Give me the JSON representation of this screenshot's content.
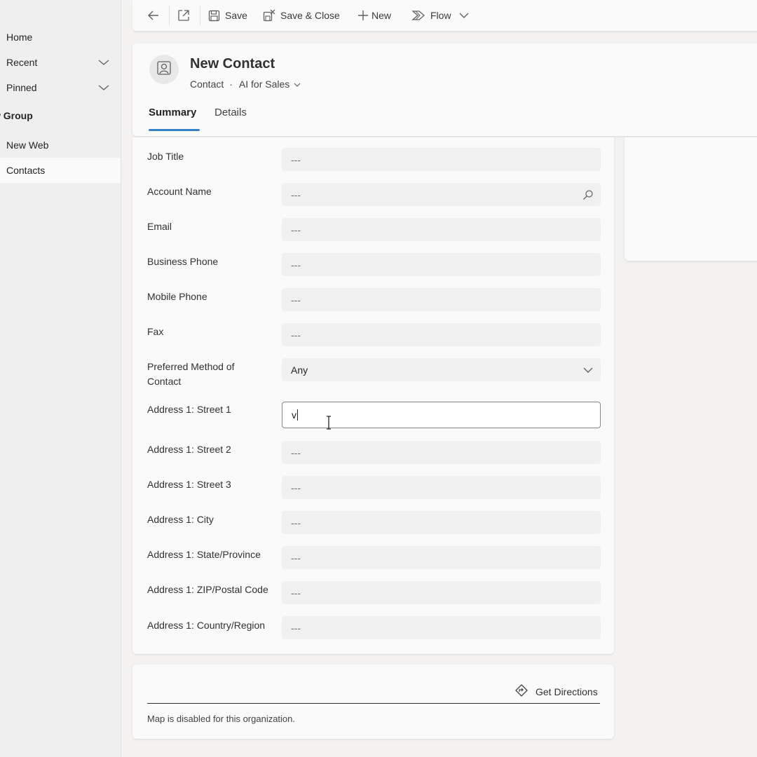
{
  "sidebar": {
    "home": "Home",
    "recent": "Recent",
    "pinned": "Pinned",
    "group": "w Group",
    "items": [
      "New Web",
      "Contacts"
    ]
  },
  "toolbar": {
    "save": "Save",
    "save_close": "Save & Close",
    "new": "New",
    "flow": "Flow"
  },
  "header": {
    "title": "New Contact",
    "entity": "Contact",
    "form_selector": "AI for Sales",
    "tabs": [
      "Summary",
      "Details"
    ],
    "selected_tab": "Summary"
  },
  "form": {
    "fields": [
      {
        "label": "Job Title",
        "value": "---"
      },
      {
        "label": "Account Name",
        "value": "---"
      },
      {
        "label": "Email",
        "value": "---"
      },
      {
        "label": "Business Phone",
        "value": "---"
      },
      {
        "label": "Mobile Phone",
        "value": "---"
      },
      {
        "label": "Fax",
        "value": "---"
      },
      {
        "label": "Preferred Method of Contact",
        "value": "Any"
      },
      {
        "label": "Address 1: Street 1",
        "value": "v"
      },
      {
        "label": "Address 1: Street 2",
        "value": "---"
      },
      {
        "label": "Address 1: Street 3",
        "value": "---"
      },
      {
        "label": "Address 1: City",
        "value": "---"
      },
      {
        "label": "Address 1: State/Province",
        "value": "---"
      },
      {
        "label": "Address 1: ZIP/Postal Code",
        "value": "---"
      },
      {
        "label": "Address 1: Country/Region",
        "value": "---"
      }
    ]
  },
  "map": {
    "directions": "Get Directions",
    "note": "Map is disabled for this organization."
  },
  "colors": {
    "accent": "#0f6cbd",
    "background": "#f3f2f1",
    "card": "#fafafa"
  }
}
